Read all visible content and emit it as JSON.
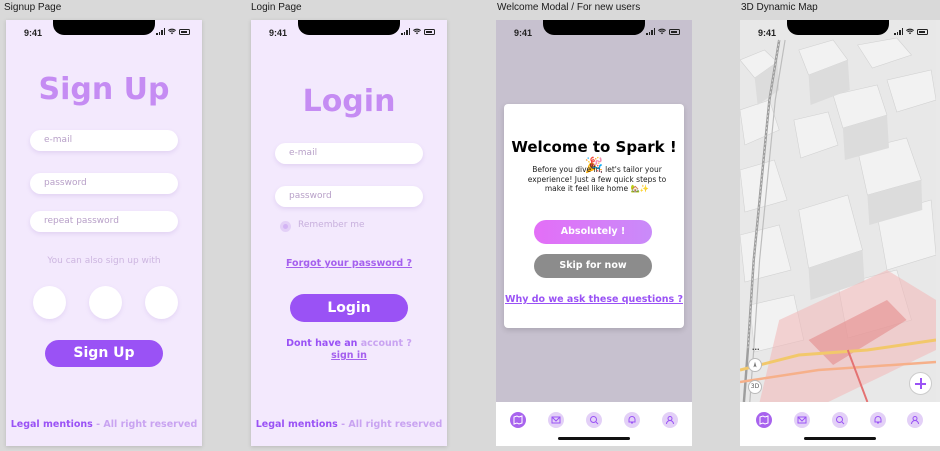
{
  "frames": {
    "signup_label": "Signup Page",
    "login_label": "Login Page",
    "welcome_label": "Welcome Modal / For new users",
    "map_label": "3D Dynamic Map"
  },
  "status": {
    "time": "9:41"
  },
  "signup": {
    "title": "Sign Up",
    "email_placeholder": "e-mail",
    "password_placeholder": "password",
    "repeat_placeholder": "repeat password",
    "alt_text": "You can also sign up with",
    "button": "Sign Up",
    "footer_a": "Legal mentions",
    "footer_b": "- All right reserved"
  },
  "login": {
    "title": "Login",
    "email_placeholder": "e-mail",
    "password_placeholder": "password",
    "remember": "Remember me",
    "forgot": "Forgot your password ?",
    "button": "Login",
    "no_account_a": "Dont have an",
    "no_account_b": "account ?",
    "sign_in": "sign in",
    "footer_a": "Legal mentions",
    "footer_b": "- All right reserved"
  },
  "welcome": {
    "title": "Welcome to Spark ! 🎉",
    "body": "Before you dive in, let's tailor your experience! Just a few quick steps to make it feel like home 🏡✨",
    "accept": "Absolutely !",
    "skip": "Skip for now",
    "why": "Why do we ask these questions ?"
  },
  "map": {
    "more": "...",
    "control_3d": "3D"
  },
  "tabbar": {
    "icons": [
      "map-icon",
      "inbox-icon",
      "search-icon",
      "bell-icon",
      "profile-icon"
    ]
  },
  "colors": {
    "accent": "#9a52f5",
    "title_light": "#c58cf3",
    "background_light": "#f3e9fd",
    "modal_dim": "#c7c1cf"
  }
}
